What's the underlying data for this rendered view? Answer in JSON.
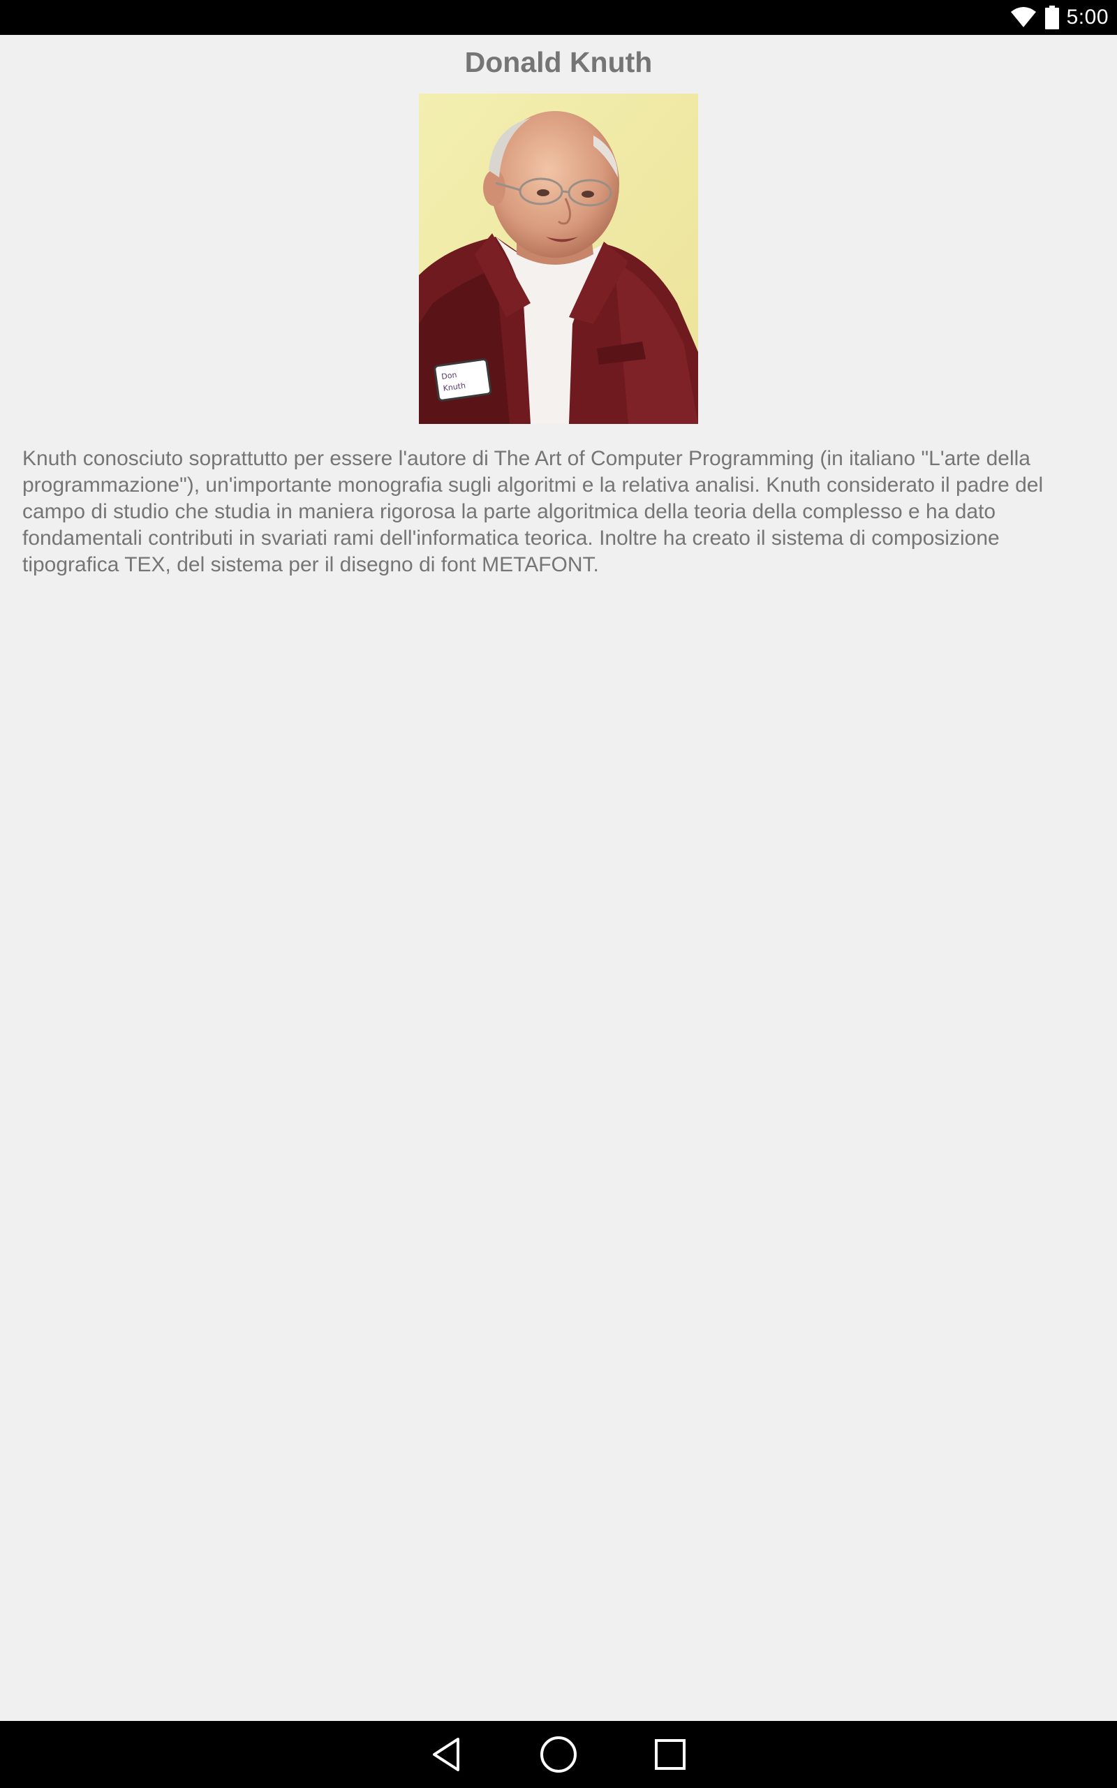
{
  "status_bar": {
    "time": "5:00",
    "icons": [
      "wifi-icon",
      "battery-icon"
    ]
  },
  "page": {
    "title": "Donald Knuth",
    "portrait": {
      "name_tag_line1": "Don",
      "name_tag_line2": "Knuth"
    },
    "bio": "Knuth conosciuto soprattutto per essere l'autore di The Art of Computer Programming (in italiano \"L'arte della programmazione\"), un'importante monografia sugli algoritmi e la relativa analisi. Knuth considerato il padre del campo di studio che studia in maniera rigorosa la parte algoritmica della teoria della complesso e ha dato fondamentali contributi in svariati rami dell'informatica teorica. Inoltre ha creato il sistema di composizione tipografica TEX, del sistema per il disegno di font METAFONT."
  },
  "nav_bar": {
    "buttons": [
      "back-icon",
      "home-icon",
      "recents-icon"
    ]
  },
  "colors": {
    "background": "#f0f0f0",
    "text": "#757575",
    "system_bars": "#000000"
  }
}
